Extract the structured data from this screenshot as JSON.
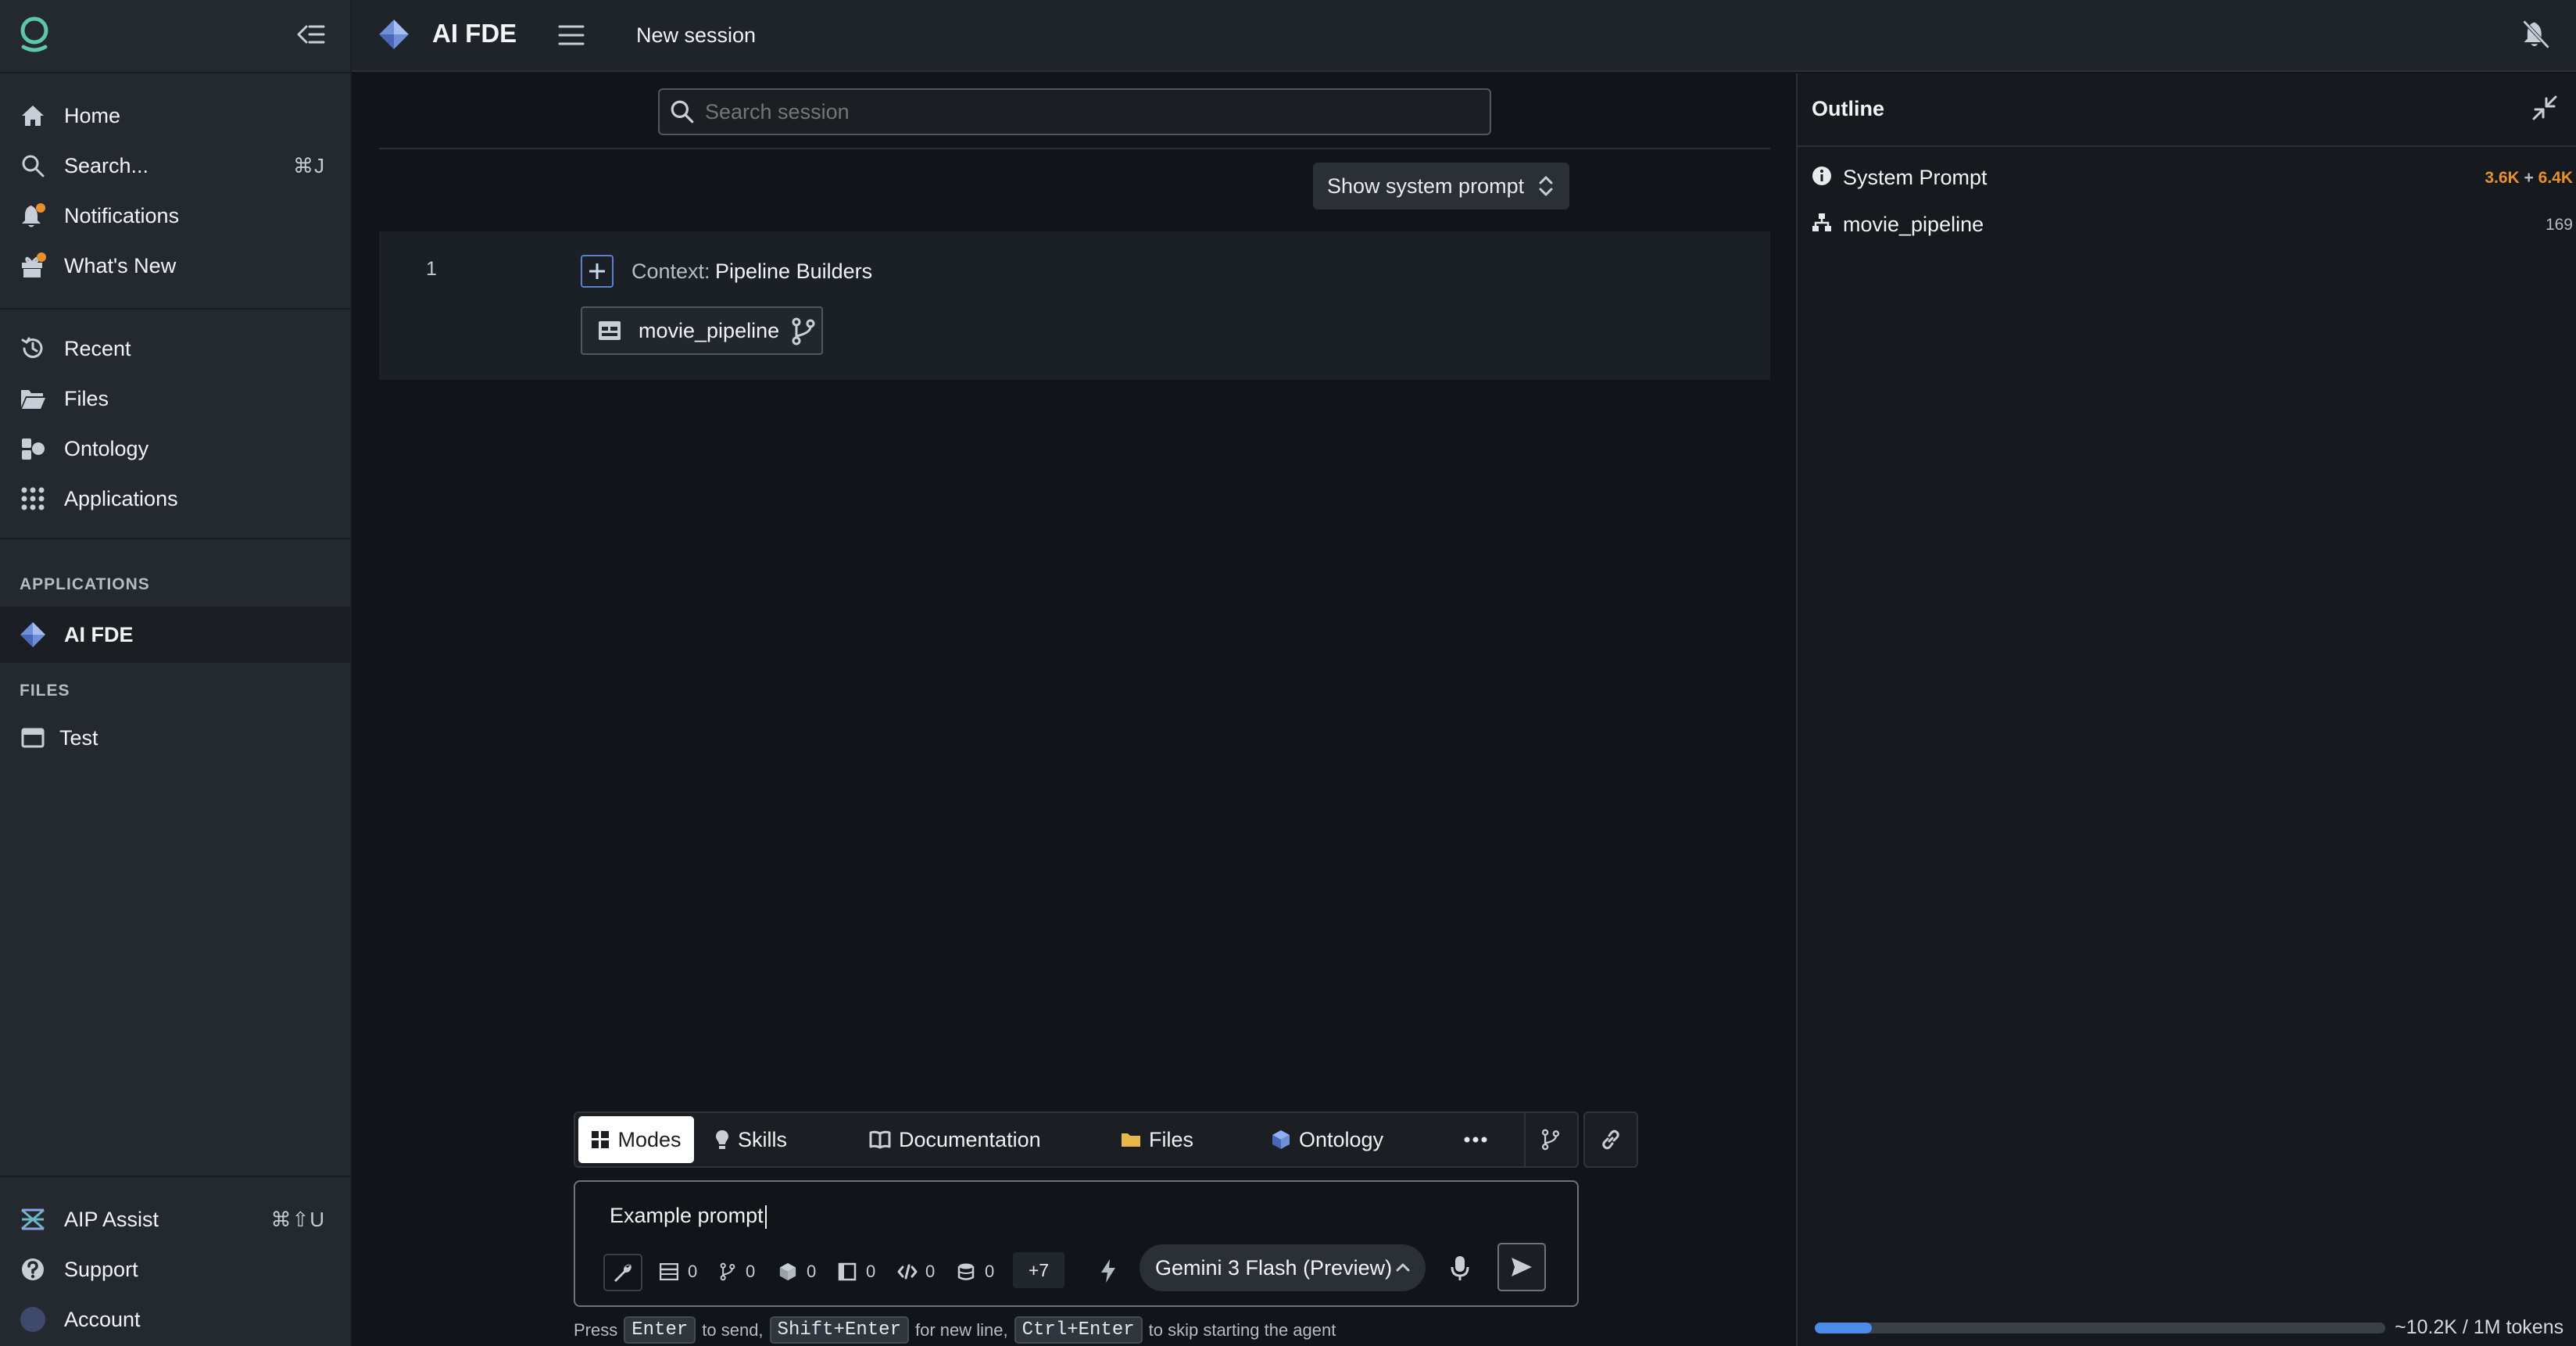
{
  "colors": {
    "accent": "#4a8ce8",
    "token_orange": "#e8902c",
    "notify_dot": "#e8902c",
    "bg": "#111418",
    "sidebar": "#24292f"
  },
  "sidebar": {
    "nav": [
      {
        "label": "Home",
        "icon": "home-icon"
      },
      {
        "label": "Search...",
        "icon": "search-icon",
        "shortcut": "⌘J"
      },
      {
        "label": "Notifications",
        "icon": "bell-icon"
      },
      {
        "label": "What's New",
        "icon": "gift-icon"
      }
    ],
    "nav2": [
      {
        "label": "Recent",
        "icon": "history-icon"
      },
      {
        "label": "Files",
        "icon": "folder-icon"
      },
      {
        "label": "Ontology",
        "icon": "cubes-icon"
      },
      {
        "label": "Applications",
        "icon": "grid-icon"
      }
    ],
    "applications_header": "APPLICATIONS",
    "app_item": "AI FDE",
    "files_header": "FILES",
    "file_item": "Test",
    "bottom": [
      {
        "label": "AIP Assist",
        "icon": "aip-icon",
        "shortcut": "⌘⇧U"
      },
      {
        "label": "Support",
        "icon": "help-icon"
      },
      {
        "label": "Account",
        "icon": "avatar"
      }
    ]
  },
  "header": {
    "app_title": "AI FDE",
    "session_title": "New session"
  },
  "search": {
    "placeholder": "Search session"
  },
  "system_prompt_toggle": "Show system prompt",
  "session": {
    "row_number": "1",
    "context_label": "Context:",
    "context_value": "Pipeline Builders",
    "resource_chip": "movie_pipeline"
  },
  "composer": {
    "tabs": [
      "Modes",
      "Skills",
      "Documentation",
      "Files",
      "Ontology"
    ],
    "input_value": "Example prompt",
    "counters": [
      "0",
      "0",
      "0",
      "0",
      "0",
      "0"
    ],
    "more_count": "+7",
    "model": "Gemini 3 Flash (Preview)",
    "hint": {
      "press": "Press",
      "enter": "Enter",
      "to_send": "to send,",
      "shift_enter": "Shift+Enter",
      "new_line": "for new line,",
      "ctrl_enter": "Ctrl+Enter",
      "skip": "to skip starting the agent"
    }
  },
  "outline": {
    "title": "Outline",
    "items": [
      {
        "label": "System Prompt",
        "tokens_a": "3.6K",
        "plus": "+",
        "tokens_b": "6.4K"
      },
      {
        "label": "movie_pipeline",
        "tokens": "169"
      }
    ],
    "usage_fraction": 0.1,
    "usage_label": "~10.2K / 1M tokens"
  }
}
